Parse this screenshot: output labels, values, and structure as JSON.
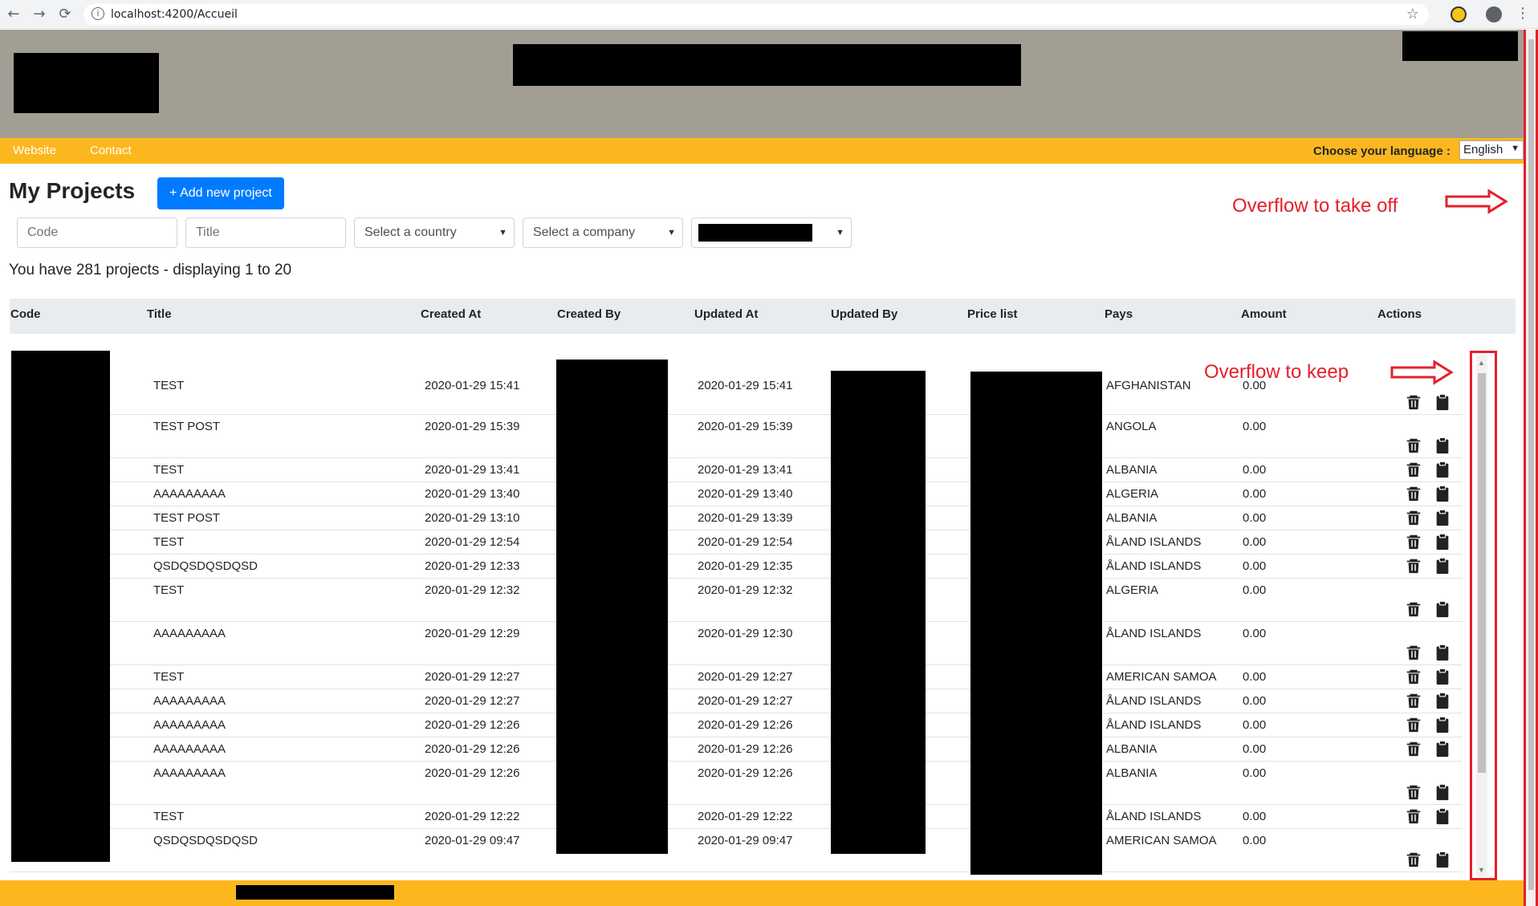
{
  "browser": {
    "url": "localhost:4200/Accueil",
    "back_icon": "arrow-left-icon",
    "forward_icon": "arrow-right-icon",
    "reload_icon": "reload-icon"
  },
  "nav": {
    "links": [
      "Website",
      "Contact"
    ],
    "language_label": "Choose your language :",
    "language_value": "English"
  },
  "page": {
    "title": "My Projects",
    "add_button": "+ Add new project",
    "filters": {
      "code_placeholder": "Code",
      "title_placeholder": "Title",
      "country_placeholder": "Select a country",
      "company_placeholder": "Select a company"
    },
    "count_text": "You have 281 projects - displaying 1 to 20"
  },
  "annotations": {
    "overflow_take_off": "Overflow to take off",
    "overflow_keep": "Overflow to keep"
  },
  "table": {
    "columns": [
      "Code",
      "Title",
      "Created At",
      "Created By",
      "Updated At",
      "Updated By",
      "Price list",
      "Pays",
      "Amount",
      "Actions"
    ],
    "rows": [
      {
        "title": "TEST",
        "created_at": "2020-01-29 15:41",
        "updated_at": "2020-01-29 15:41",
        "pays": "AFGHANISTAN",
        "amount": "0.00"
      },
      {
        "title": "TEST POST",
        "created_at": "2020-01-29 15:39",
        "updated_at": "2020-01-29 15:39",
        "pays": "ANGOLA",
        "amount": "0.00"
      },
      {
        "title": "TEST",
        "created_at": "2020-01-29 13:41",
        "updated_at": "2020-01-29 13:41",
        "pays": "ALBANIA",
        "amount": "0.00"
      },
      {
        "title": "AAAAAAAAA",
        "created_at": "2020-01-29 13:40",
        "updated_at": "2020-01-29 13:40",
        "pays": "ALGERIA",
        "amount": "0.00"
      },
      {
        "title": "TEST POST",
        "created_at": "2020-01-29 13:10",
        "updated_at": "2020-01-29 13:39",
        "pays": "ALBANIA",
        "amount": "0.00"
      },
      {
        "title": "TEST",
        "created_at": "2020-01-29 12:54",
        "updated_at": "2020-01-29 12:54",
        "pays": "ÅLAND ISLANDS",
        "amount": "0.00"
      },
      {
        "title": "QSDQSDQSDQSD",
        "created_at": "2020-01-29 12:33",
        "updated_at": "2020-01-29 12:35",
        "pays": "ÅLAND ISLANDS",
        "amount": "0.00"
      },
      {
        "title": "TEST",
        "created_at": "2020-01-29 12:32",
        "updated_at": "2020-01-29 12:32",
        "pays": "ALGERIA",
        "amount": "0.00"
      },
      {
        "title": "AAAAAAAAA",
        "created_at": "2020-01-29 12:29",
        "updated_at": "2020-01-29 12:30",
        "pays": "ÅLAND ISLANDS",
        "amount": "0.00"
      },
      {
        "title": "TEST",
        "created_at": "2020-01-29 12:27",
        "updated_at": "2020-01-29 12:27",
        "pays": "AMERICAN SAMOA",
        "amount": "0.00"
      },
      {
        "title": "AAAAAAAAA",
        "created_at": "2020-01-29 12:27",
        "updated_at": "2020-01-29 12:27",
        "pays": "ÅLAND ISLANDS",
        "amount": "0.00"
      },
      {
        "title": "AAAAAAAAA",
        "created_at": "2020-01-29 12:26",
        "updated_at": "2020-01-29 12:26",
        "pays": "ÅLAND ISLANDS",
        "amount": "0.00"
      },
      {
        "title": "AAAAAAAAA",
        "created_at": "2020-01-29 12:26",
        "updated_at": "2020-01-29 12:26",
        "pays": "ALBANIA",
        "amount": "0.00"
      },
      {
        "title": "AAAAAAAAA",
        "created_at": "2020-01-29 12:26",
        "updated_at": "2020-01-29 12:26",
        "pays": "ALBANIA",
        "amount": "0.00"
      },
      {
        "title": "TEST",
        "created_at": "2020-01-29 12:22",
        "updated_at": "2020-01-29 12:22",
        "pays": "ÅLAND ISLANDS",
        "amount": "0.00"
      },
      {
        "title": "QSDQSDQSDQSD",
        "created_at": "2020-01-29 09:47",
        "updated_at": "2020-01-29 09:47",
        "pays": "AMERICAN SAMOA",
        "amount": "0.00"
      }
    ]
  }
}
